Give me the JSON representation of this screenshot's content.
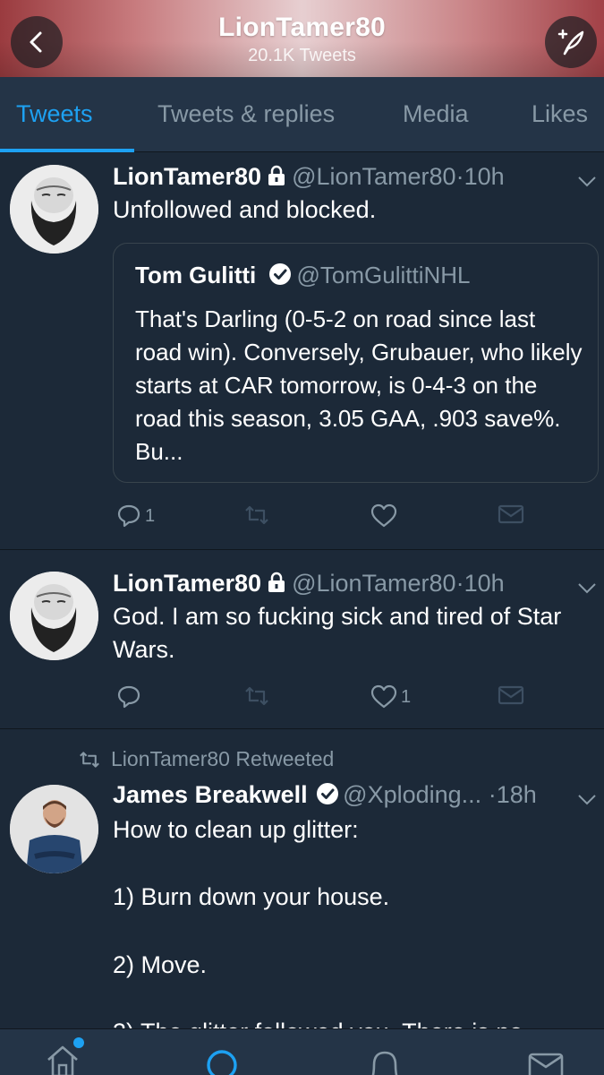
{
  "header": {
    "title": "LionTamer80",
    "subtitle": "20.1K Tweets",
    "back_icon": "chevron-left-icon",
    "compose_icon": "compose-feather-icon"
  },
  "tabs": [
    {
      "label": "Tweets",
      "active": true
    },
    {
      "label": "Tweets & replies",
      "active": false
    },
    {
      "label": "Media",
      "active": false
    },
    {
      "label": "Likes",
      "active": false
    }
  ],
  "tweets": [
    {
      "name": "LionTamer80",
      "handle": "@LionTamer80",
      "sep": "·",
      "time": "10h",
      "protected": true,
      "text": "Unfollowed and blocked.",
      "quote": {
        "name": "Tom Gulitti",
        "handle": "@TomGulittiNHL",
        "verified": true,
        "text": "That's Darling (0-5-2 on road since last road win). Conversely, Grubauer, who likely starts at CAR tomorrow,  is 0-4-3 on the road this season, 3.05 GAA, .903 save%. Bu..."
      },
      "reply_count": "1",
      "like_count": ""
    },
    {
      "name": "LionTamer80",
      "handle": "@LionTamer80",
      "sep": "·",
      "time": "10h",
      "protected": true,
      "text": "God. I am so fucking sick and tired of Star Wars.",
      "reply_count": "",
      "like_count": "1"
    },
    {
      "retweeted_by": "LionTamer80 Retweeted",
      "name": "James Breakwell",
      "handle": "@Xploding...",
      "sep": "·",
      "time": "18h",
      "verified": true,
      "text": "How to clean up glitter:\n\n1) Burn down your house.\n\n2) Move.\n\n3) The glitter followed you. There is no"
    }
  ],
  "colors": {
    "background": "#1c2938",
    "bar": "#243447",
    "accent": "#1da1f2",
    "muted": "#8899a6"
  },
  "bottom_nav": [
    "home-icon",
    "search-icon",
    "notifications-bell-icon",
    "messages-envelope-icon"
  ]
}
